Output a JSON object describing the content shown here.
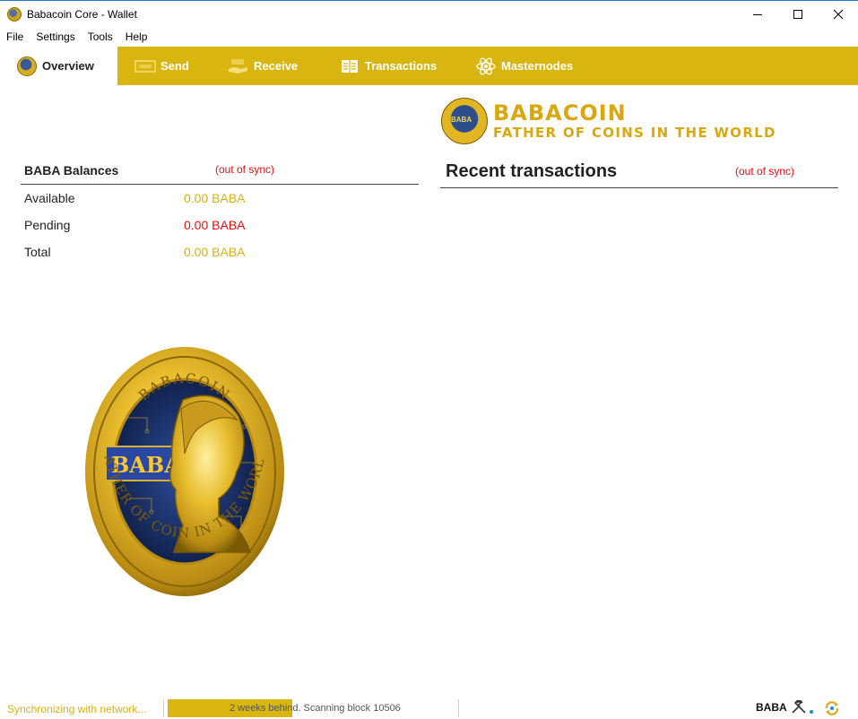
{
  "window": {
    "title": "Babacoin Core - Wallet"
  },
  "menu": [
    "File",
    "Settings",
    "Tools",
    "Help"
  ],
  "tabs": [
    {
      "label": "Overview",
      "icon": "coin-icon",
      "active": true
    },
    {
      "label": "Send",
      "icon": "send-icon"
    },
    {
      "label": "Receive",
      "icon": "receive-icon"
    },
    {
      "label": "Transactions",
      "icon": "transactions-icon"
    },
    {
      "label": "Masternodes",
      "icon": "masternodes-icon"
    }
  ],
  "brand": {
    "name": "BABACOIN",
    "tagline": "FATHER OF COINS IN THE WORLD",
    "coin_label": "BABA"
  },
  "balances": {
    "title": "BABA Balances",
    "sync_status": "(out of sync)",
    "rows": [
      {
        "label": "Available",
        "value": "0.00 BABA",
        "color": "gold"
      },
      {
        "label": "Pending",
        "value": "0.00 BABA",
        "color": "red"
      },
      {
        "label": "Total",
        "value": "0.00 BABA",
        "color": "gold"
      }
    ]
  },
  "recent": {
    "title": "Recent transactions",
    "sync_status": "(out of sync)"
  },
  "big_coin": {
    "top_text": "BABACOIN",
    "center_text": "BABA",
    "ring_text": "FATHER OF COIN IN THE WORLD"
  },
  "status": {
    "sync_label": "Synchronizing with network...",
    "progress_text": "2 weeks behind. Scanning block 10506",
    "progress_fraction": 0.43,
    "unit": "BABA"
  },
  "colors": {
    "accent": "#d9b60f",
    "gold_text": "#d9b012",
    "error": "#e01010"
  }
}
